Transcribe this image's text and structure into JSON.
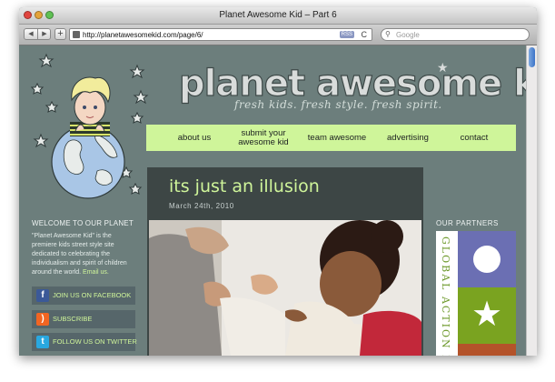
{
  "window": {
    "title": "Planet Awesome Kid – Part 6"
  },
  "toolbar": {
    "back_icon": "back-arrow-icon",
    "forward_icon": "forward-arrow-icon",
    "add": "+",
    "url": "http://planetawesomekid.com/page/6/",
    "rss_badge": "RSS",
    "reload": "C",
    "search_placeholder": "Google"
  },
  "header": {
    "site_title": "planet awesome kid",
    "tagline": "fresh kids. fresh style. fresh spirit."
  },
  "nav": {
    "items": [
      {
        "label": "about us"
      },
      {
        "label": "submit your awesome kid"
      },
      {
        "label": "team awesome"
      },
      {
        "label": "advertising"
      },
      {
        "label": "contact"
      }
    ]
  },
  "sidebar": {
    "welcome_title": "WELCOME TO OUR PLANET",
    "welcome_text": "\"Planet Awesome Kid\" is the premiere kids street style site dedicated to celebrating the individualism and spirit of children around the world.",
    "email_link": "Email us.",
    "social": [
      {
        "label": "JOIN US ON FACEBOOK",
        "icon": "facebook-icon",
        "glyph": "f"
      },
      {
        "label": "SUBSCRIBE",
        "icon": "rss-icon",
        "glyph": ")"
      },
      {
        "label": "FOLLOW US ON TWITTER",
        "icon": "twitter-icon",
        "glyph": "t"
      }
    ]
  },
  "post": {
    "title": "its just an illusion",
    "date": "March 24th, 2010"
  },
  "partners": {
    "title": "OUR PARTNERS",
    "ad_text": "GLOBAL ACTION FO"
  },
  "colors": {
    "page_bg": "#6c7e7c",
    "accent_green": "#cff59a",
    "post_bg": "#3d4645"
  }
}
